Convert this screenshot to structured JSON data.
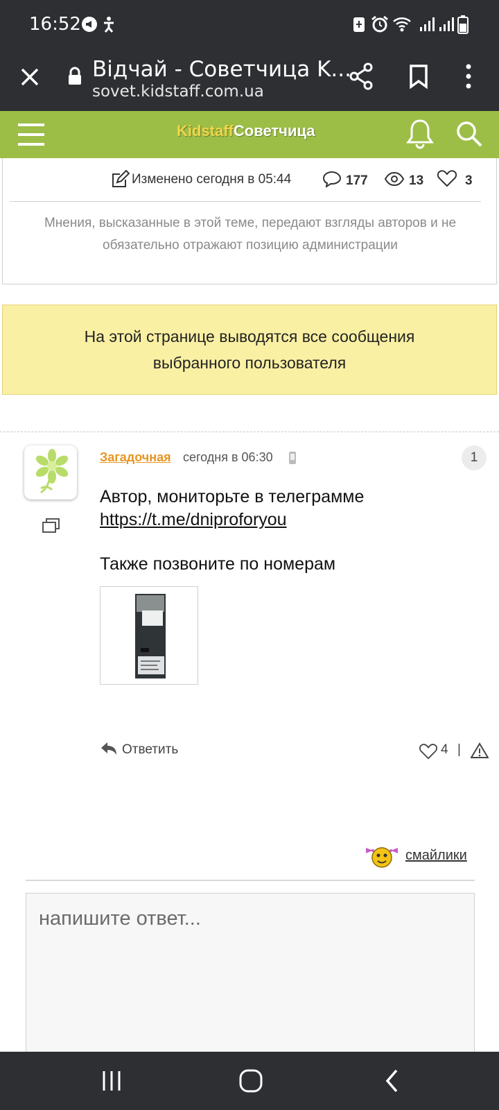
{
  "status_bar": {
    "time": "16:52"
  },
  "browser": {
    "title": "Відчай - Советчица K...",
    "url": "sovet.kidstaff.com.ua"
  },
  "site": {
    "logo_part1": "Kidstaff",
    "logo_part2": "Советчица"
  },
  "topic": {
    "edited": "Изменено сегодня в 05:44",
    "comments": "177",
    "views": "13",
    "likes": "3",
    "disclaimer_line1": "Мнения, высказанные в этой теме, передают взгляды авторов и не",
    "disclaimer_line2": "обязательно отражают позицию администрации"
  },
  "notice": {
    "line1": "На этой странице выводятся все сообщения",
    "line2": "выбранного пользователя"
  },
  "post": {
    "username": "Загадочная",
    "time": "сегодня в 06:30",
    "number": "1",
    "line1": "Автор, мониторьте в телеграмме",
    "link": "https://t.me/dniproforyou",
    "line2": "Также позвоните по номерам",
    "reply_label": "Ответить",
    "likes": "4",
    "separator": "|"
  },
  "reply_box": {
    "smileys_label": "смайлики",
    "placeholder": "напишите ответ..."
  }
}
